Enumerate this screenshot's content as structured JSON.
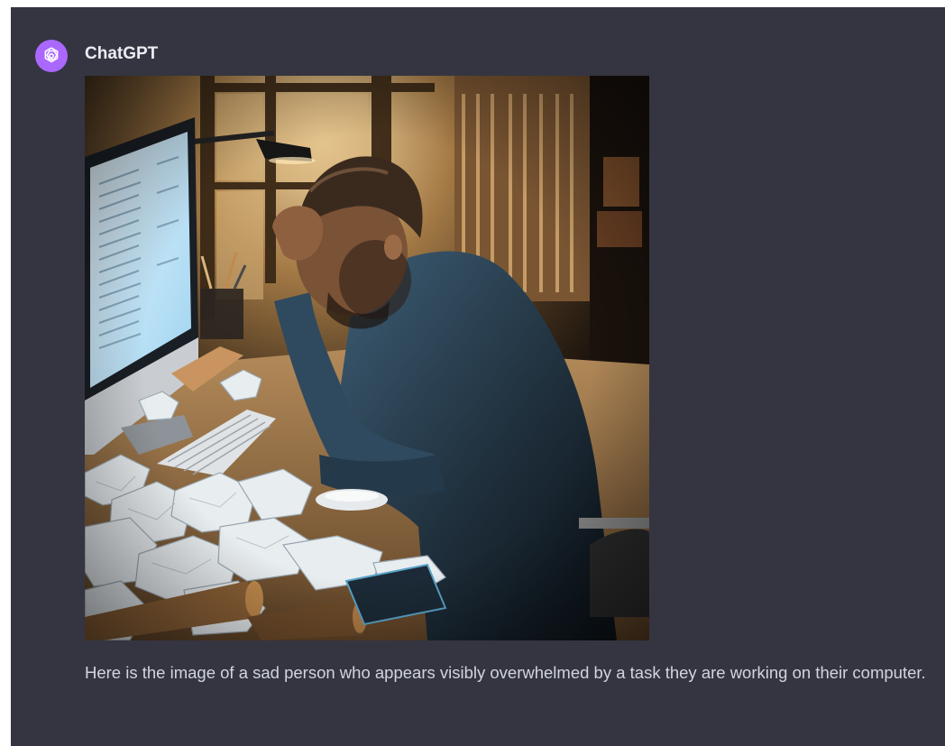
{
  "message": {
    "sender": "ChatGPT",
    "avatar_icon": "openai-logo-icon",
    "avatar_color": "#ab68ff",
    "text": "Here is the image of a sad person who appears visibly overwhelmed by a task they are working on their computer."
  },
  "theme": {
    "panel_background": "#343541",
    "name_color": "#ececf1",
    "text_color": "#d1d5db"
  }
}
